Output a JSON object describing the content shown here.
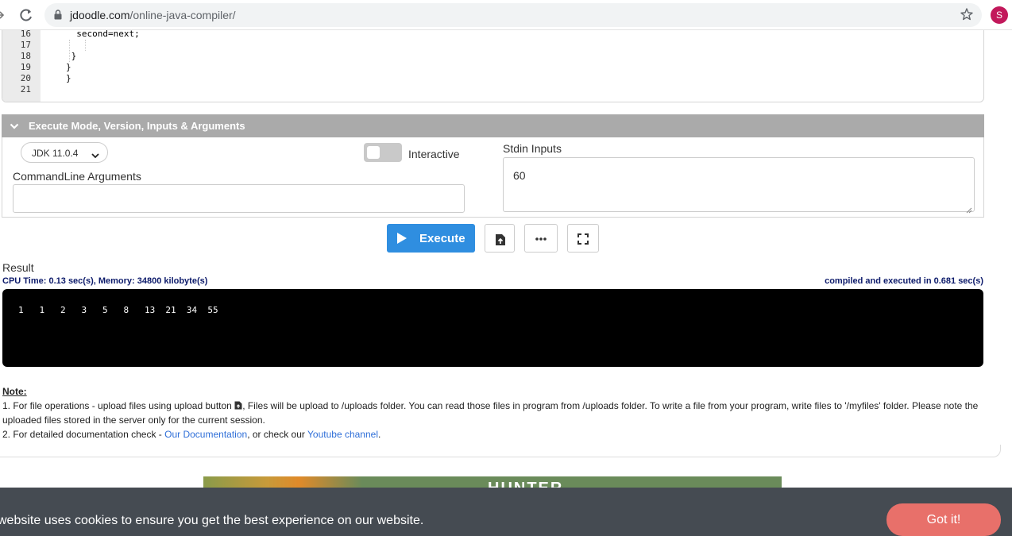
{
  "browser": {
    "url_host": "jdoodle.com",
    "url_path": "/online-java-compiler/",
    "profile_initial": "S"
  },
  "editor": {
    "lines": [
      {
        "no": "16",
        "code": "  second=next;"
      },
      {
        "no": "17",
        "code": ""
      },
      {
        "no": "18",
        "code": " }"
      },
      {
        "no": "19",
        "code": "}"
      },
      {
        "no": "20",
        "code": "}"
      },
      {
        "no": "21",
        "code": ""
      }
    ]
  },
  "execute_panel": {
    "title": "Execute Mode, Version, Inputs & Arguments",
    "jdk_version": "JDK 11.0.4",
    "interactive_label": "Interactive",
    "interactive_on": false,
    "stdin_label": "Stdin Inputs",
    "stdin_value": "60",
    "cmd_label": "CommandLine Arguments",
    "cmd_value": ""
  },
  "actions": {
    "execute_label": "Execute"
  },
  "result": {
    "label": "Result",
    "cpu_time": "CPU Time: 0.13 sec(s), Memory: 34800 kilobyte(s)",
    "compiled": "compiled and executed in 0.681 sec(s)",
    "output": "1   1   2   3   5   8   13  21  34  55"
  },
  "notes": {
    "title": "Note:",
    "line1_a": "1. For file operations - upload files using upload button ",
    "line1_b": ", Files will be upload to /uploads folder. You can read those files in program from /uploads folder. To write a file from your program, write files to '/myfiles' folder. Please note the uploaded files stored in the server only for the current session.",
    "line2_a": "2. For detailed documentation check - ",
    "doc_link": "Our Documentation",
    "line2_b": ", or check our ",
    "youtube_link": "Youtube channel",
    "line2_c": "."
  },
  "ad": {
    "text": "HUNTER"
  },
  "cookie": {
    "text": "website uses cookies to ensure you get the best experience on our website.",
    "button": "Got it!"
  },
  "colors": {
    "execute_blue": "#2f8ee0",
    "panel_header": "#aaaaaa",
    "cookie_bg": "#454b52",
    "cookie_button": "#e8706a",
    "link": "#2f6fd8",
    "stats_text": "#0d1b6b"
  }
}
